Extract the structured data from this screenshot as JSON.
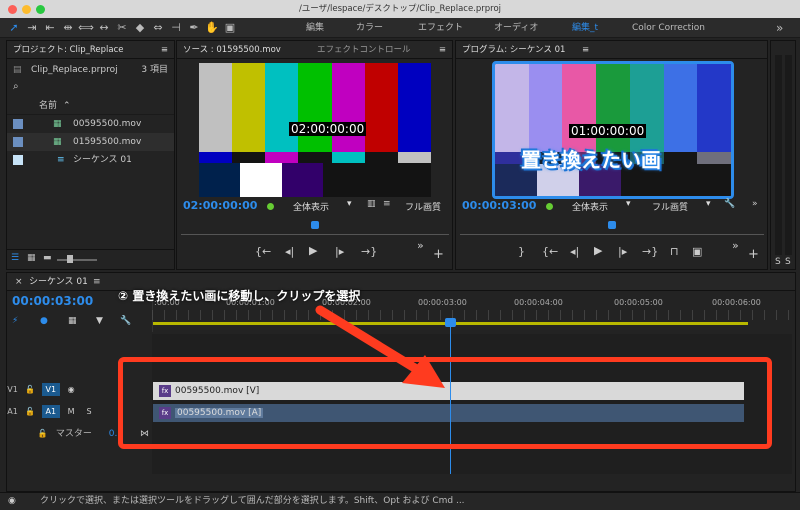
{
  "window": {
    "title": "/ユーザ/lespace/デスクトップ/Clip_Replace.prproj"
  },
  "workspaces": {
    "items": [
      "編集",
      "カラー",
      "エフェクト",
      "オーディオ",
      "編集_t",
      "Color Correction"
    ],
    "more": "»"
  },
  "project": {
    "title": "プロジェクト: Clip_Replace",
    "menu": "≡",
    "file": "Clip_Replace.prproj",
    "count": "3 項目",
    "col_name": "名前",
    "items": [
      "00595500.mov",
      "01595500.mov",
      "シーケンス 01"
    ]
  },
  "source": {
    "tab1": "ソース : 01595500.mov",
    "tab2": "エフェクトコントロール",
    "menu": "≡",
    "overlay_tc": "02:00:00:00",
    "tc": "02:00:00:00",
    "zoom": "全体表示",
    "quality": "フル画質"
  },
  "program": {
    "title": "プログラム: シーケンス 01",
    "menu": "≡",
    "overlay_tc": "01:00:00:00",
    "annotation": "置き換えたい画",
    "tc": "00:00:03:00",
    "zoom": "全体表示",
    "quality": "フル画質"
  },
  "meter": {
    "s1": "S",
    "s2": "S"
  },
  "timeline": {
    "tab": "シーケンス 01",
    "close": "×",
    "menu": "≡",
    "tc": "00:00:03:00",
    "ruler": [
      ":00:00",
      "00:00:01:00",
      "00:00:02:00",
      "00:00:03:00",
      "00:00:04:00",
      "00:00:05:00",
      "00:00:06:00"
    ],
    "annotation": "② 置き換えたい画に移動し、クリップを選択",
    "v1_label": "V1",
    "v1_target": "V1",
    "a1_label": "A1",
    "a1_target": "A1",
    "mute": "M",
    "solo": "S",
    "master_label": "マスター",
    "master_val": "0.0",
    "clip_v": "00595500.mov [V]",
    "clip_a": "00595500.mov [A]"
  },
  "status": {
    "text": "クリックで選択、または選択ツールをドラッグして囲んだ部分を選択します。Shift、Opt および Cmd ..."
  },
  "colors": {
    "accent": "#2d8ceb",
    "annotation": "#ff3b1f"
  }
}
